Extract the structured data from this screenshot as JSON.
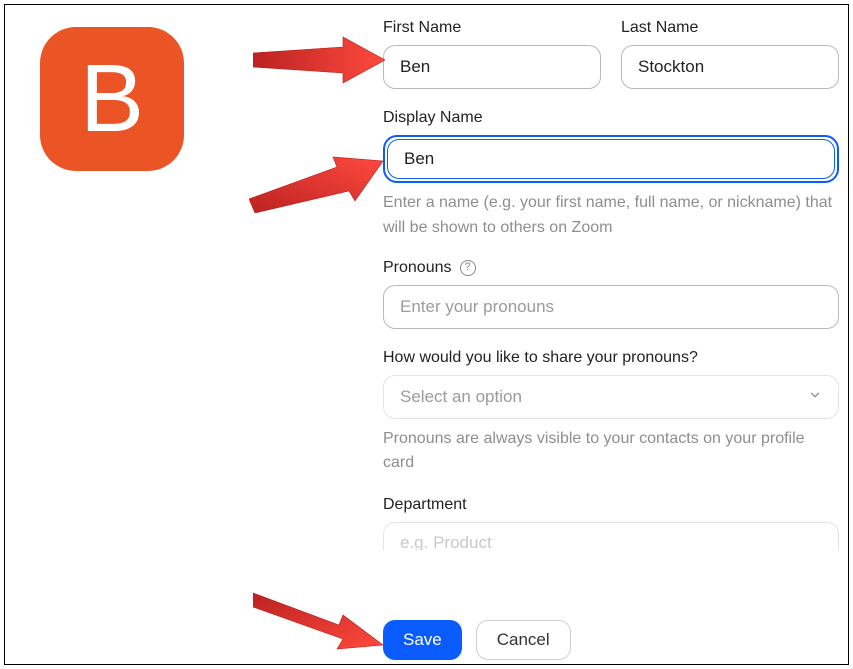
{
  "avatar": {
    "initial": "B"
  },
  "fields": {
    "first_name": {
      "label": "First Name",
      "value": "Ben"
    },
    "last_name": {
      "label": "Last Name",
      "value": "Stockton"
    },
    "display_name": {
      "label": "Display Name",
      "value": "Ben",
      "hint": "Enter a name (e.g. your first name, full name, or nickname) that will be shown to others on Zoom"
    },
    "pronouns": {
      "label": "Pronouns",
      "placeholder": "Enter your pronouns",
      "value": ""
    },
    "pronouns_share": {
      "label": "How would you like to share your pronouns?",
      "selected": "Select an option",
      "hint": "Pronouns are always visible to your contacts on your profile card"
    },
    "department": {
      "label": "Department",
      "placeholder": "e.g. Product"
    }
  },
  "buttons": {
    "save": "Save",
    "cancel": "Cancel"
  },
  "colors": {
    "accent": "#0b5cff",
    "avatar_bg": "#eb5424",
    "arrow": "#ed3833"
  }
}
